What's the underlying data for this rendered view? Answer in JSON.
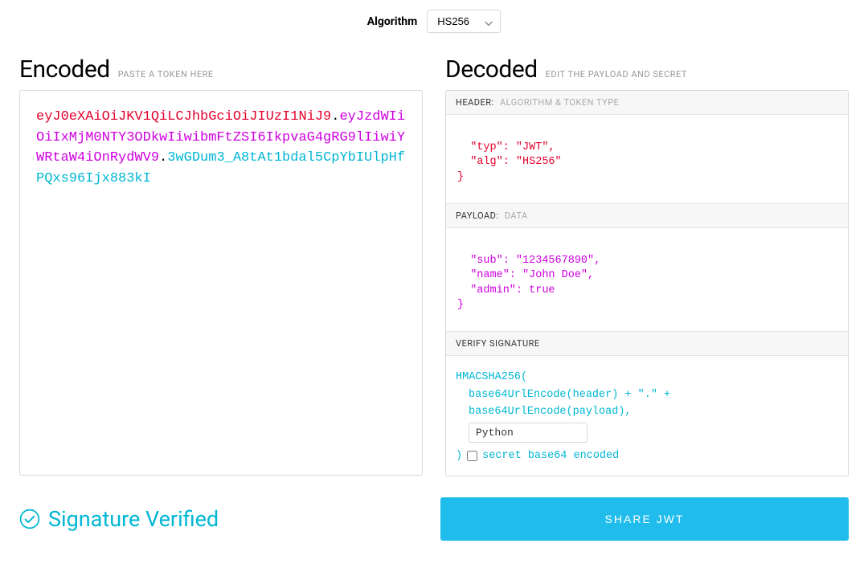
{
  "algorithm": {
    "label": "Algorithm",
    "selected": "HS256"
  },
  "encoded": {
    "title": "Encoded",
    "subtitle": "PASTE A TOKEN HERE",
    "token_header": "eyJ0eXAiOiJKV1QiLCJhbGciOiJIUzI1NiJ9",
    "token_payload": "eyJzdWIiOiIxMjM0NTY3ODkwIiwibmFtZSI6IkpvaG4gRG9lIiwiYWRtaW4iOnRydWV9",
    "token_signature": "3wGDum3_A8tAt1bdal5CpYbIUlpHfPQxs96Ijx883kI"
  },
  "decoded": {
    "title": "Decoded",
    "subtitle": "EDIT THE PAYLOAD AND SECRET",
    "header_bar_label": "HEADER:",
    "header_bar_sub": "ALGORITHM & TOKEN TYPE",
    "header_json_line1": "  \"typ\": \"JWT\",",
    "header_json_line2": "  \"alg\": \"HS256\"",
    "header_json_line3": "}",
    "payload_bar_label": "PAYLOAD:",
    "payload_bar_sub": "DATA",
    "payload_json_line1": "  \"sub\": \"1234567890\",",
    "payload_json_line2": "  \"name\": \"John Doe\",",
    "payload_json_line3": "  \"admin\": true",
    "payload_json_line4": "}",
    "verify_bar_label": "VERIFY SIGNATURE",
    "sig_line1": "HMACSHA256(",
    "sig_line2": "base64UrlEncode(header) + \".\" +",
    "sig_line3": "base64UrlEncode(payload),",
    "secret_value": "Python",
    "sig_close": ")",
    "secret_label": "secret base64 encoded"
  },
  "footer": {
    "verified_text": "Signature Verified",
    "share_label": "SHARE JWT"
  },
  "colors": {
    "red": "#e3002c",
    "purple": "#cf00e0",
    "cyan": "#00b7d4",
    "share_bg": "#1fbcec"
  }
}
